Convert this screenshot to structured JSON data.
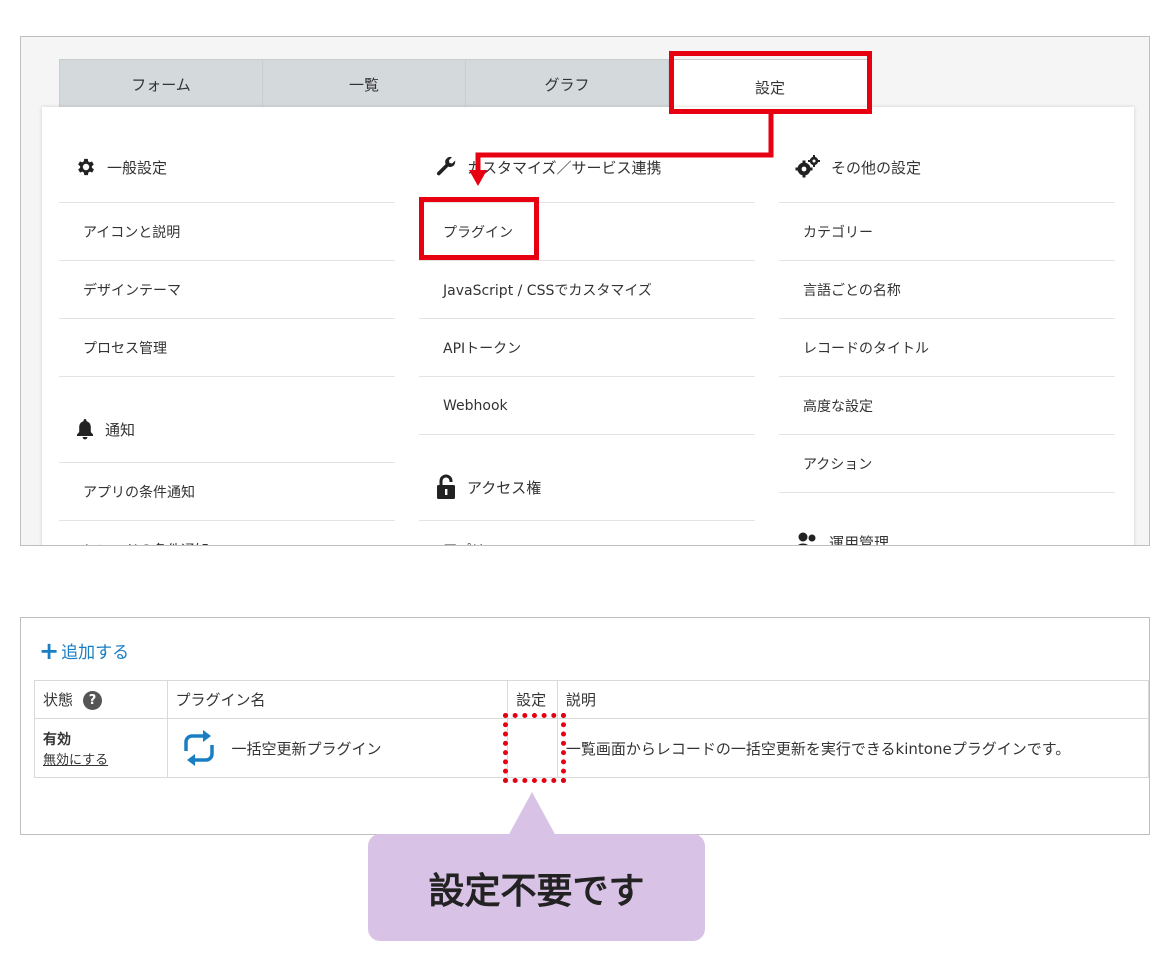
{
  "tabs": [
    "フォーム",
    "一覧",
    "グラフ",
    "設定"
  ],
  "general": {
    "heading": "一般設定",
    "items": [
      "アイコンと説明",
      "デザインテーマ",
      "プロセス管理"
    ]
  },
  "notify": {
    "heading": "通知",
    "items": [
      "アプリの条件通知",
      "レコードの条件通知"
    ]
  },
  "customize": {
    "heading": "カスタマイズ／サービス連携",
    "items": [
      "プラグイン",
      "JavaScript / CSSでカスタマイズ",
      "APIトークン",
      "Webhook"
    ]
  },
  "access": {
    "heading": "アクセス権",
    "items": [
      "アプリ"
    ]
  },
  "other": {
    "heading": "その他の設定",
    "items": [
      "カテゴリー",
      "言語ごとの名称",
      "レコードのタイトル",
      "高度な設定",
      "アクション"
    ]
  },
  "ops": {
    "heading": "運用管理"
  },
  "plugin_list": {
    "add_label": "追加する",
    "columns": [
      "状態",
      "プラグイン名",
      "設定",
      "説明"
    ],
    "row": {
      "status": "有効",
      "status_action": "無効にする",
      "name": "一括空更新プラグイン",
      "description": "一覧画面からレコードの一括空更新を実行できるkintoneプラグインです。"
    }
  },
  "callout_text": "設定不要です",
  "colors": {
    "annotation_red": "#e60012",
    "callout_bg": "#d8c3e6",
    "link_blue": "#1a7ec4"
  }
}
